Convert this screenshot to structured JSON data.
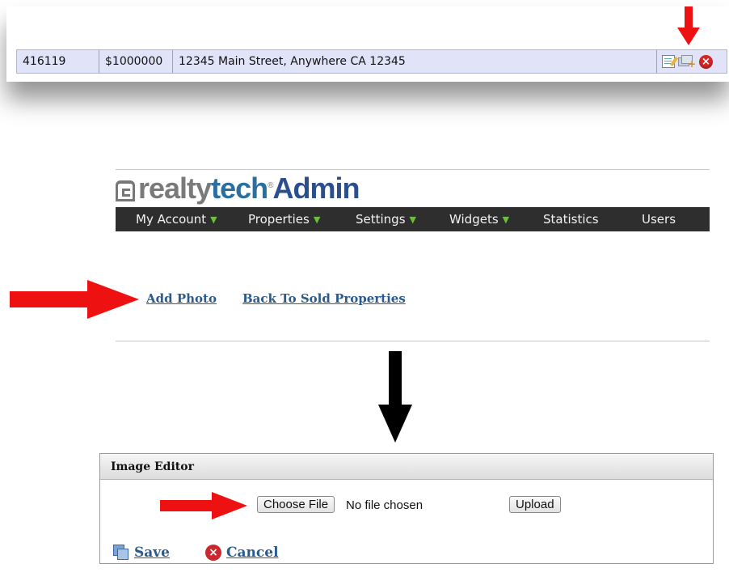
{
  "listing_row": {
    "id": "416119",
    "price": "$1000000",
    "address": "12345 Main Street, Anywhere CA 12345",
    "action_icons": [
      "edit-icon",
      "add-photo-icon",
      "delete-icon"
    ]
  },
  "logo": {
    "realty": "realty",
    "tech": "tech",
    "admin": "Admin",
    "registered": "®"
  },
  "nav": {
    "items": [
      {
        "label": "My Account",
        "has_dropdown": true
      },
      {
        "label": "Properties",
        "has_dropdown": true
      },
      {
        "label": "Settings",
        "has_dropdown": true
      },
      {
        "label": "Widgets",
        "has_dropdown": true
      },
      {
        "label": "Statistics",
        "has_dropdown": false
      },
      {
        "label": "Users",
        "has_dropdown": false
      }
    ],
    "dropdown_glyph": "▼"
  },
  "links": {
    "add_photo": "Add Photo",
    "back_to_sold": "Back To Sold Properties"
  },
  "image_editor": {
    "title": "Image Editor",
    "choose_file_label": "Choose File",
    "no_file_text": "No file chosen",
    "upload_label": "Upload",
    "save_label": "Save",
    "cancel_label": "Cancel"
  },
  "colors": {
    "row_bg": "#e1e3f9",
    "nav_bg": "#2e2e2e",
    "link": "#2a5a8e",
    "arrow_red": "#ee1111",
    "arrow_black": "#000000"
  }
}
